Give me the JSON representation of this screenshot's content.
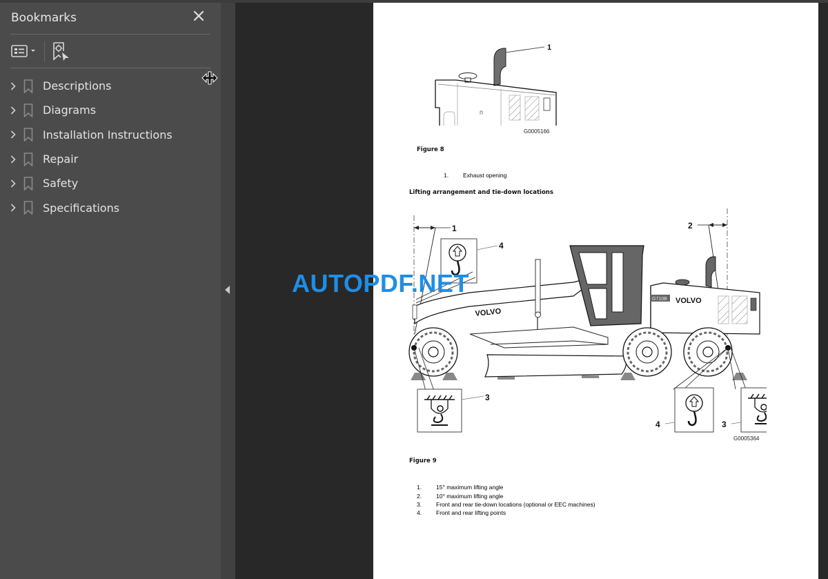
{
  "sidebar": {
    "title": "Bookmarks",
    "close_icon": "close-icon",
    "toolbar": {
      "options_icon": "list-options-icon",
      "options_dropdown_icon": "caret-down-icon",
      "find_bookmark_icon": "find-current-bookmark-icon"
    },
    "items": [
      {
        "label": "Descriptions"
      },
      {
        "label": "Diagrams"
      },
      {
        "label": "Installation Instructions"
      },
      {
        "label": "Repair"
      },
      {
        "label": "Safety"
      },
      {
        "label": "Specifications"
      }
    ]
  },
  "document": {
    "figure8": {
      "callout": "1",
      "code": "G0005166",
      "caption": "Figure 8",
      "legend": [
        {
          "num": "1.",
          "text": "Exhaust opening"
        }
      ]
    },
    "section_heading": "Lifting arrangement and tie-down locations",
    "figure9": {
      "callouts": {
        "c1": "1",
        "c2": "2",
        "c3a": "3",
        "c3b": "3",
        "c4a": "4",
        "c4b": "4"
      },
      "brand_front": "VOLVO",
      "brand_rear": "VOLVO",
      "model": "G710B",
      "code": "G0005364",
      "caption": "Figure 9",
      "legend": [
        {
          "num": "1.",
          "text": "15° maximum lifting angle"
        },
        {
          "num": "2.",
          "text": "10° maximum lifting angle"
        },
        {
          "num": "3.",
          "text": "Front and rear tie-down locations (optional or EEC machines)"
        },
        {
          "num": "4.",
          "text": "Front and rear lifting points"
        }
      ]
    }
  },
  "watermark": "AUTOPDF.NET",
  "colors": {
    "sidebar_bg": "#4b4b4b",
    "canvas_bg": "#282828",
    "watermark": "#1e8ee6"
  }
}
